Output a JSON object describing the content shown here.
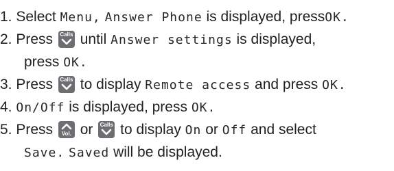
{
  "steps": [
    {
      "num": "1.",
      "t1": "Select",
      "menu": "Menu,",
      "answer_phone": "Answer Phone",
      "t2": "is displayed, press",
      "ok": "OK."
    },
    {
      "num": "2.",
      "t1": "Press",
      "t2": "until",
      "answer_settings": "Answer settings",
      "t3": "is displayed,",
      "t4": "press",
      "ok": "OK."
    },
    {
      "num": "3.",
      "t1": "Press",
      "t2": "to display",
      "remote_access": "Remote access",
      "t3": "and press",
      "ok": "OK."
    },
    {
      "num": "4.",
      "on_off": "On/Off",
      "t1": "is displayed, press",
      "ok": "OK."
    },
    {
      "num": "5.",
      "t1": "Press",
      "t2": "or",
      "t3": "to display",
      "on": "On",
      "t4": "or",
      "off": "Off",
      "t5": "and select",
      "save": "Save.",
      "saved": "Saved",
      "t6": "will be displayed."
    }
  ],
  "keys": {
    "calls_label": "Calls",
    "vol_label": "Vol.",
    "calls_icon": "chevron-down-icon",
    "vol_icon": "chevron-up-icon",
    "key_color": "#6d6e71"
  }
}
